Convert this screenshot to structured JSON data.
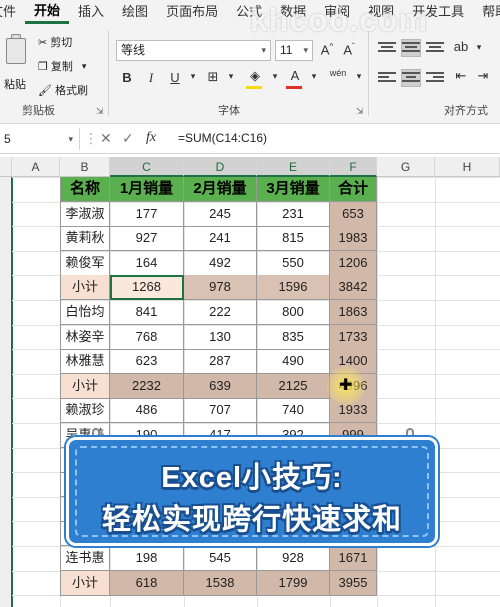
{
  "ribbon": {
    "tabs": [
      "文件",
      "开始",
      "插入",
      "绘图",
      "页面布局",
      "公式",
      "数据",
      "审阅",
      "视图",
      "开发工具",
      "帮助"
    ],
    "clipboard": {
      "paste": "粘贴",
      "cut": "剪切",
      "copy": "复制",
      "format_painter": "格式刷",
      "group": "剪贴板"
    },
    "font": {
      "name": "等线",
      "size": "11",
      "bold": "B",
      "italic": "I",
      "underline": "U",
      "wen": "wén",
      "group": "字体"
    },
    "alignment": {
      "group": "对齐方式"
    }
  },
  "formula_bar": {
    "cell_ref": "5",
    "formula": "=SUM(C14:C16)"
  },
  "columns": [
    "A",
    "B",
    "C",
    "D",
    "E",
    "F",
    "G",
    "H"
  ],
  "table": {
    "headers": [
      "名称",
      "1月销量",
      "2月销量",
      "3月销量",
      "合计"
    ],
    "rows": [
      [
        "李淑淑",
        "177",
        "245",
        "231",
        "653"
      ],
      [
        "黄莉秋",
        "927",
        "241",
        "815",
        "1983"
      ],
      [
        "赖俊军",
        "164",
        "492",
        "550",
        "1206"
      ],
      [
        "小计",
        "1268",
        "978",
        "1596",
        "3842"
      ],
      [
        "白怡均",
        "841",
        "222",
        "800",
        "1863"
      ],
      [
        "林姿辛",
        "768",
        "130",
        "835",
        "1733"
      ],
      [
        "林雅慧",
        "623",
        "287",
        "490",
        "1400"
      ],
      [
        "小计",
        "2232",
        "639",
        "2125",
        "4996"
      ],
      [
        "赖淑珍",
        "486",
        "707",
        "740",
        "1933"
      ],
      [
        "吴惠美",
        "190",
        "417",
        "392",
        "999"
      ],
      [
        "",
        "",
        "",
        "",
        ""
      ],
      [
        "",
        "",
        "",
        "",
        ""
      ],
      [
        "",
        "",
        "",
        "",
        ""
      ],
      [
        "",
        "",
        "",
        "",
        ""
      ],
      [
        "连书惠",
        "198",
        "545",
        "928",
        "1671"
      ],
      [
        "小计",
        "618",
        "1538",
        "1799",
        "3955"
      ]
    ]
  },
  "banner": {
    "line1": "Excel小技巧:",
    "line2": "轻松实现跨行快速求和"
  },
  "watermark": "khcoo.com",
  "colors": {
    "header_green": "#5ab04e",
    "subtotal_peach": "#f7e0d2",
    "total_brown": "#d2b8a8",
    "banner_blue": "#2f7fd0"
  }
}
